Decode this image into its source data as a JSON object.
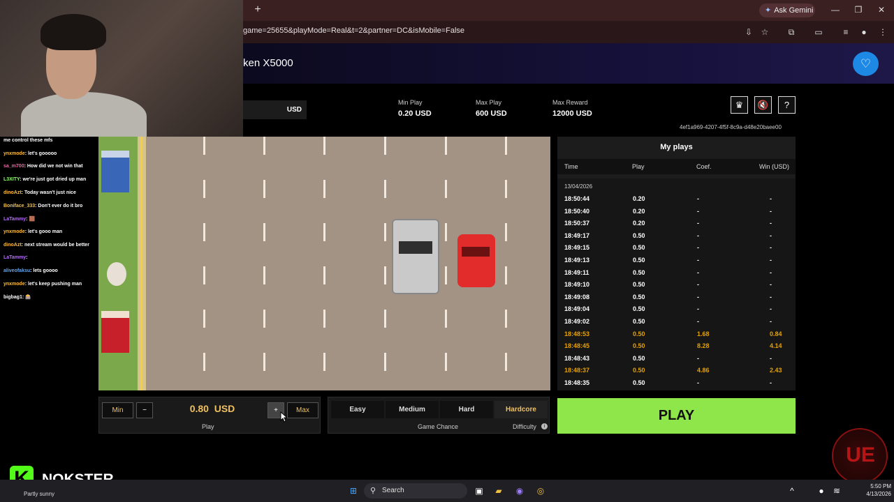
{
  "browser": {
    "url": "game=25655&playMode=Real&t=2&partner=DC&isMobile=False",
    "ask_gemini": "Ask Gemini"
  },
  "header": {
    "title": "ken X5000"
  },
  "stake": {
    "currency": "USD"
  },
  "limits": {
    "min_play_label": "Min Play",
    "min_play_value": "0.20 USD",
    "max_play_label": "Max Play",
    "max_play_value": "600 USD",
    "max_reward_label": "Max Reward",
    "max_reward_value": "12000 USD"
  },
  "toolbar": {
    "help_label": "?"
  },
  "session_hash": "4ef1a969-4207-4f5f-8c9a-d48e20baee00",
  "my_plays": {
    "title": "My plays",
    "columns": [
      "Time",
      "Play",
      "Coef.",
      "Win (USD)"
    ],
    "date": "13/04/2026",
    "rows": [
      {
        "time": "18:50:44",
        "play": "0.20",
        "coef": "-",
        "win": "-",
        "winner": false
      },
      {
        "time": "18:50:40",
        "play": "0.20",
        "coef": "-",
        "win": "-",
        "winner": false
      },
      {
        "time": "18:50:37",
        "play": "0.20",
        "coef": "-",
        "win": "-",
        "winner": false
      },
      {
        "time": "18:49:17",
        "play": "0.50",
        "coef": "-",
        "win": "-",
        "winner": false
      },
      {
        "time": "18:49:15",
        "play": "0.50",
        "coef": "-",
        "win": "-",
        "winner": false
      },
      {
        "time": "18:49:13",
        "play": "0.50",
        "coef": "-",
        "win": "-",
        "winner": false
      },
      {
        "time": "18:49:11",
        "play": "0.50",
        "coef": "-",
        "win": "-",
        "winner": false
      },
      {
        "time": "18:49:10",
        "play": "0.50",
        "coef": "-",
        "win": "-",
        "winner": false
      },
      {
        "time": "18:49:08",
        "play": "0.50",
        "coef": "-",
        "win": "-",
        "winner": false
      },
      {
        "time": "18:49:04",
        "play": "0.50",
        "coef": "-",
        "win": "-",
        "winner": false
      },
      {
        "time": "18:49:02",
        "play": "0.50",
        "coef": "-",
        "win": "-",
        "winner": false
      },
      {
        "time": "18:48:53",
        "play": "0.50",
        "coef": "1.68",
        "win": "0.84",
        "winner": true
      },
      {
        "time": "18:48:45",
        "play": "0.50",
        "coef": "8.28",
        "win": "4.14",
        "winner": true
      },
      {
        "time": "18:48:43",
        "play": "0.50",
        "coef": "-",
        "win": "-",
        "winner": false
      },
      {
        "time": "18:48:37",
        "play": "0.50",
        "coef": "4.86",
        "win": "2.43",
        "winner": true
      },
      {
        "time": "18:48:35",
        "play": "0.50",
        "coef": "-",
        "win": "-",
        "winner": false
      }
    ]
  },
  "controls": {
    "min_label": "Min",
    "minus_label": "−",
    "amount": "0.80",
    "amount_currency": "USD",
    "plus_label": "+",
    "max_label": "Max",
    "play_caption": "Play",
    "difficulties": [
      "Easy",
      "Medium",
      "Hard",
      "Hardcore"
    ],
    "active_difficulty": "Hardcore",
    "game_chance_caption": "Game Chance",
    "difficulty_caption": "Difficulty",
    "info_glyph": "i",
    "play_button": "PLAY"
  },
  "chat": [
    {
      "user": "",
      "text": "me control these mfs",
      "color": "#ffffff"
    },
    {
      "user": "ynxmode",
      "text": ": let's gooooo",
      "color": "#ffbf3d"
    },
    {
      "user": "sa_m700",
      "text": ": How did we not win that",
      "color": "#ff5fa8"
    },
    {
      "user": "L3XITY",
      "text": ": we're just got dried up man",
      "color": "#8cff6a"
    },
    {
      "user": "dinoAzt",
      "text": ": Today wasn't just nice",
      "color": "#ffbf3d"
    },
    {
      "user": "Boniface_333",
      "text": ": Don't ever do it bro",
      "color": "#ffbf3d"
    },
    {
      "user": "LaTammy",
      "text": ": 🟫",
      "color": "#b86bff"
    },
    {
      "user": "ynxmode",
      "text": ": let's gooo man",
      "color": "#ffbf3d"
    },
    {
      "user": "dinoAzt",
      "text": ": next stream would be better",
      "color": "#ffbf3d"
    },
    {
      "user": "LaTammy",
      "text": ": ",
      "color": "#b86bff"
    },
    {
      "user": "aliveofaksu",
      "text": ": lets goooo",
      "color": "#5fa8ff"
    },
    {
      "user": "ynxmode",
      "text": ": let's keep pushing man",
      "color": "#ffbf3d"
    },
    {
      "user": "bigbag1",
      "text": ": 🎰",
      "color": "#ffffff"
    }
  ],
  "overlay": {
    "brand": "NOKSTER",
    "brand_logo": "K",
    "emblem_text": "UE"
  },
  "taskbar": {
    "weather": "Partly sunny",
    "search": "Search",
    "time": "5:50 PM",
    "date": "4/13/2026"
  }
}
